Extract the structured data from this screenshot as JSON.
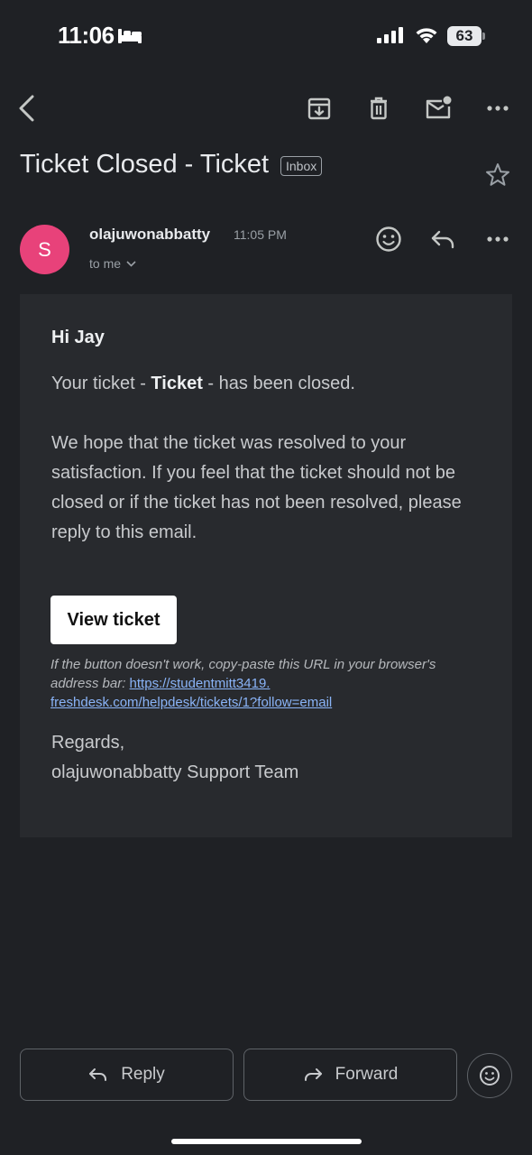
{
  "status_bar": {
    "time": "11:06",
    "battery": "63"
  },
  "toolbar": {
    "icons": [
      "back-icon",
      "archive-icon",
      "trash-icon",
      "mark-unread-icon",
      "more-icon"
    ]
  },
  "email": {
    "subject": "Ticket Closed - Ticket",
    "label": "Inbox",
    "sender": {
      "initial": "S",
      "name": "olajuwonabbatty",
      "time": "11:05 PM",
      "recipient": "to me",
      "avatar_color": "#e8427a"
    },
    "body": {
      "greeting": "Hi Jay",
      "line1_before": "Your ticket - ",
      "line1_bold": "Ticket",
      "line1_after": " - has been closed.",
      "paragraph2": "We hope that the ticket was resolved to your satisfaction. If you feel that the ticket should not be closed or if the ticket has not been resolved, please reply to this email.",
      "button_label": "View ticket",
      "note_text": "If the button doesn't work, copy-paste this URL in your browser's address bar: ",
      "url_part1": "https://studentmitt3419.",
      "url_part2": "freshdesk.com/helpdesk/tickets/1?follow=email",
      "regards": "Regards,",
      "signature": "olajuwonabbatty Support Team"
    }
  },
  "actions": {
    "reply_label": "Reply",
    "forward_label": "Forward"
  },
  "colors": {
    "background": "#1f2125",
    "card": "#282a2e",
    "link": "#8ab4f8"
  }
}
